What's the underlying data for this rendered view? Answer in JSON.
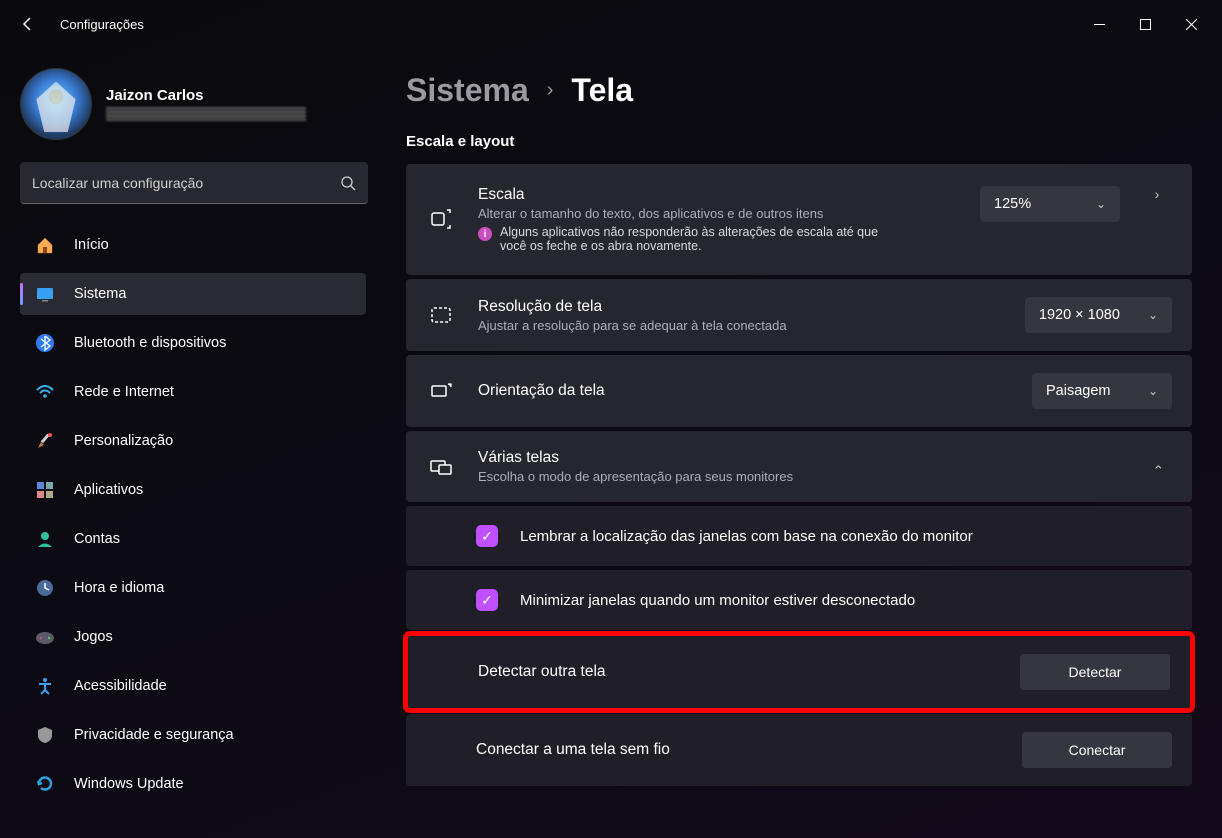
{
  "window": {
    "title": "Configurações"
  },
  "profile": {
    "name": "Jaizon Carlos"
  },
  "search": {
    "placeholder": "Localizar uma configuração"
  },
  "sidebar": {
    "items": [
      {
        "label": "Início"
      },
      {
        "label": "Sistema"
      },
      {
        "label": "Bluetooth e dispositivos"
      },
      {
        "label": "Rede e Internet"
      },
      {
        "label": "Personalização"
      },
      {
        "label": "Aplicativos"
      },
      {
        "label": "Contas"
      },
      {
        "label": "Hora e idioma"
      },
      {
        "label": "Jogos"
      },
      {
        "label": "Acessibilidade"
      },
      {
        "label": "Privacidade e segurança"
      },
      {
        "label": "Windows Update"
      }
    ]
  },
  "breadcrumb": {
    "parent": "Sistema",
    "current": "Tela"
  },
  "main": {
    "section_title": "Escala e layout",
    "scale": {
      "title": "Escala",
      "subtitle": "Alterar o tamanho do texto, dos aplicativos e de outros itens",
      "warning": "Alguns aplicativos não responderão às alterações de escala até que você os feche e os abra novamente.",
      "value": "125%"
    },
    "resolution": {
      "title": "Resolução de tela",
      "subtitle": "Ajustar a resolução para se adequar à tela conectada",
      "value": "1920 × 1080"
    },
    "orientation": {
      "title": "Orientação da tela",
      "value": "Paisagem"
    },
    "multi": {
      "title": "Várias telas",
      "subtitle": "Escolha o modo de apresentação para seus monitores",
      "checkbox1": "Lembrar a localização das janelas com base na conexão do monitor",
      "checkbox2": "Minimizar janelas quando um monitor estiver desconectado",
      "detect_label": "Detectar outra tela",
      "detect_button": "Detectar",
      "connect_label": "Conectar a uma tela sem fio",
      "connect_button": "Conectar"
    }
  }
}
